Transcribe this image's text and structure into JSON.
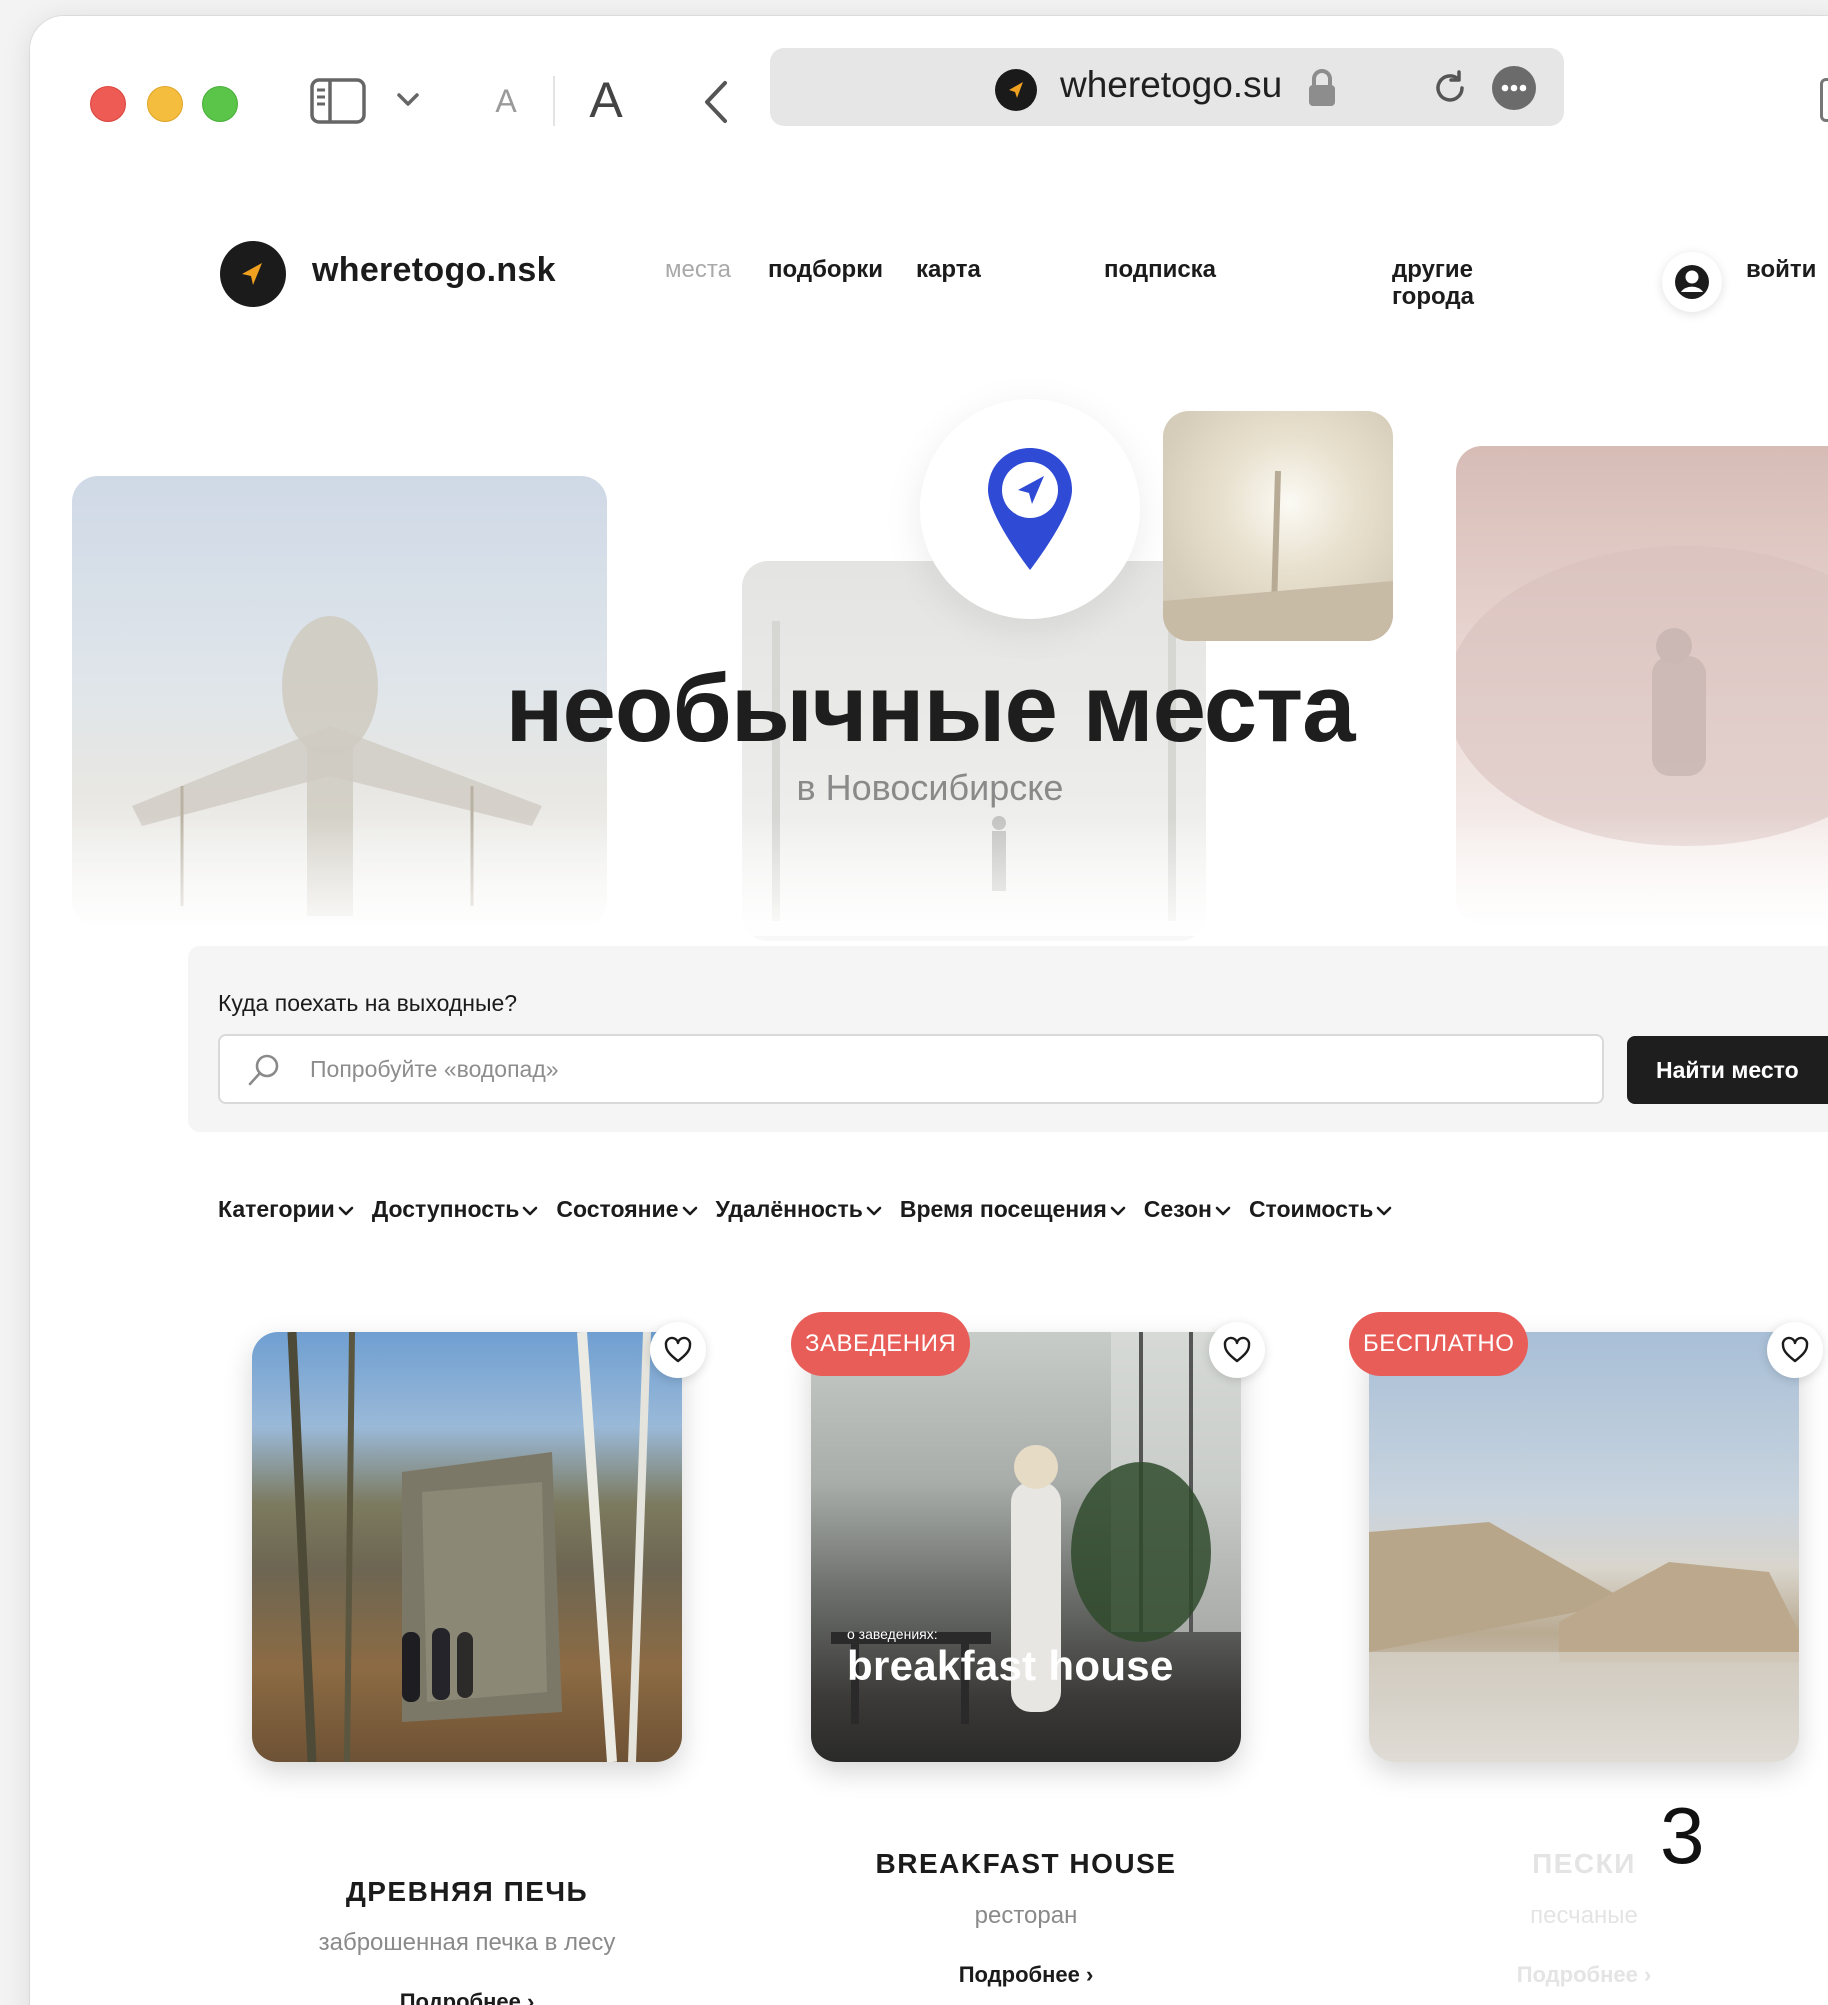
{
  "browser": {
    "url": "wheretogo.su",
    "font_small_label": "A",
    "font_large_label": "A"
  },
  "site": {
    "logo_text": "wheretogo.nsk",
    "nav": {
      "places": "места",
      "collections": "подборки",
      "map": "карта",
      "subscription": "подписка",
      "other_cities": "другие\nгорода",
      "login": "войти"
    }
  },
  "hero": {
    "title": "необычные места",
    "subtitle": "в Новосибирске"
  },
  "search": {
    "label": "Куда поехать на выходные?",
    "placeholder": "Попробуйте «водопад»",
    "value": "",
    "button": "Найти место"
  },
  "filters": [
    "Категории",
    "Доступность",
    "Состояние",
    "Удалённость",
    "Время посещения",
    "Сезон",
    "Стоимость"
  ],
  "cards": [
    {
      "badge": "",
      "title": "ДРЕВНЯЯ ПЕЧЬ",
      "subtitle": "заброшенная печка в лесу",
      "more": "Подробнее ›"
    },
    {
      "badge": "ЗАВЕДЕНИЯ",
      "overlay_small": "о заведениях:",
      "overlay_big": "breakfast house",
      "title": "BREAKFAST HOUSE",
      "subtitle": "ресторан",
      "more": "Подробнее ›"
    },
    {
      "badge": "БЕСПЛАТНО",
      "title": "ПЕСКИ",
      "subtitle": "песчаные",
      "more": "Подробнее ›"
    }
  ],
  "step_marker": "3",
  "colors": {
    "accent_blue": "#2f4bd6",
    "badge_red": "#e85d58",
    "button_dark": "#1e1e1e",
    "logo_arrow": "#f0a020"
  }
}
